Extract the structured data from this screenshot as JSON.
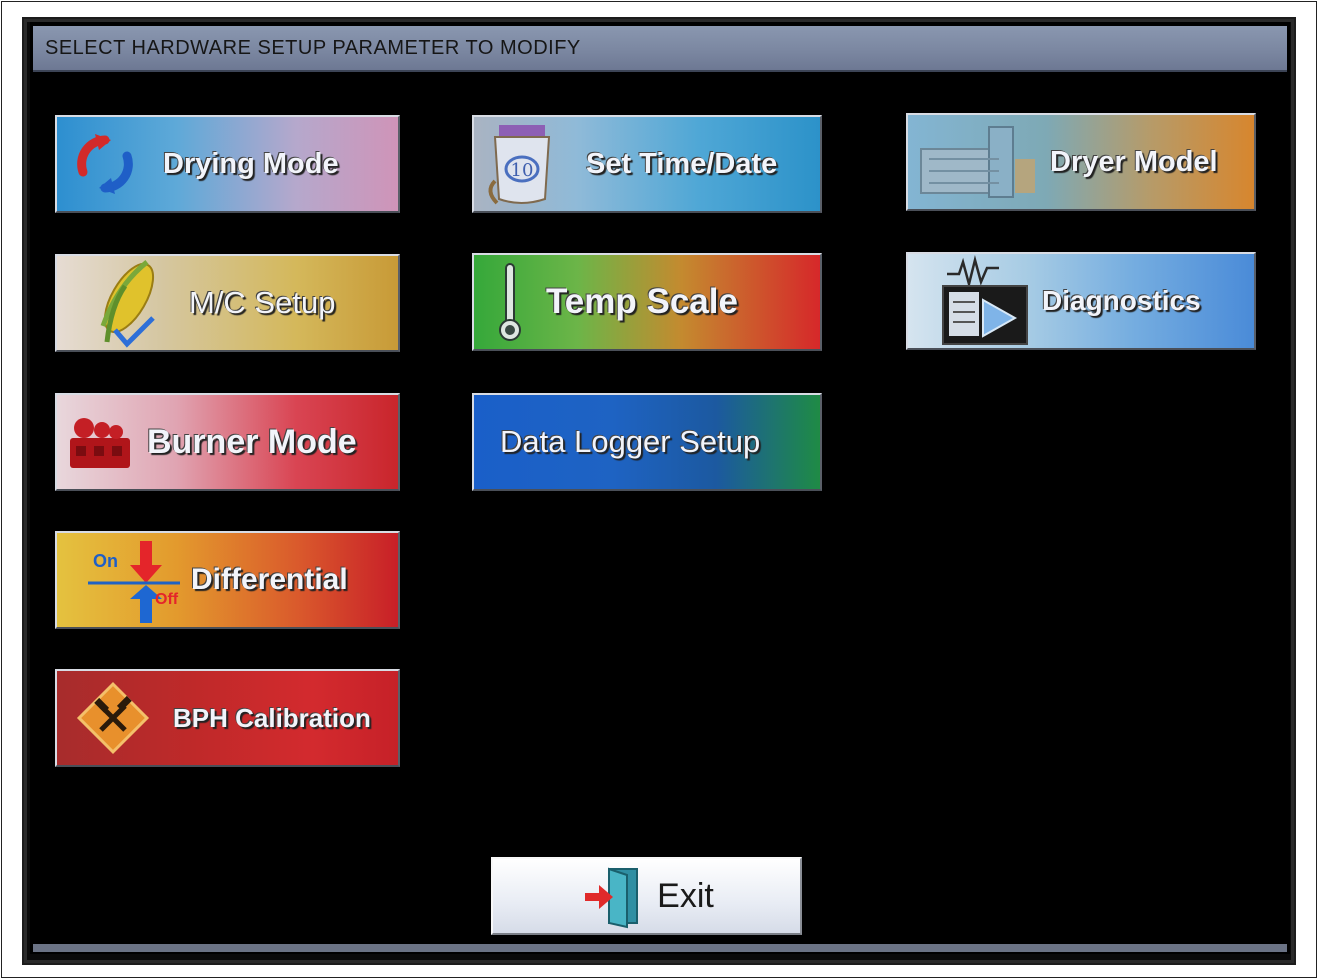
{
  "header": {
    "title": "SELECT HARDWARE SETUP PARAMETER TO MODIFY"
  },
  "buttons": {
    "drying_mode": "Drying Mode",
    "set_time_date": "Set Time/Date",
    "dryer_model": "Dryer Model",
    "mc_setup": "M/C Setup",
    "temp_scale": "Temp Scale",
    "diagnostics": "Diagnostics",
    "burner_mode": "Burner Mode",
    "data_logger_setup": "Data Logger Setup",
    "differential": "Differential",
    "bph_calibration": "BPH Calibration",
    "exit": "Exit"
  },
  "differential_icon": {
    "on": "On",
    "off": "Off"
  },
  "icons": {
    "drying_mode": "refresh-arrows-icon",
    "set_time_date": "calendar-icon",
    "dryer_model": "grain-dryer-icon",
    "mc_setup": "corn-checkmark-icon",
    "temp_scale": "thermometer-icon",
    "diagnostics": "monitor-waveform-icon",
    "burner_mode": "burner-icon",
    "differential": "on-off-arrows-icon",
    "bph_calibration": "tools-diamond-icon",
    "exit": "exit-door-icon"
  },
  "colors": {
    "screen_background": "#000000",
    "title_bar": "#7a86a0",
    "label_text": "#f2f4fa"
  }
}
